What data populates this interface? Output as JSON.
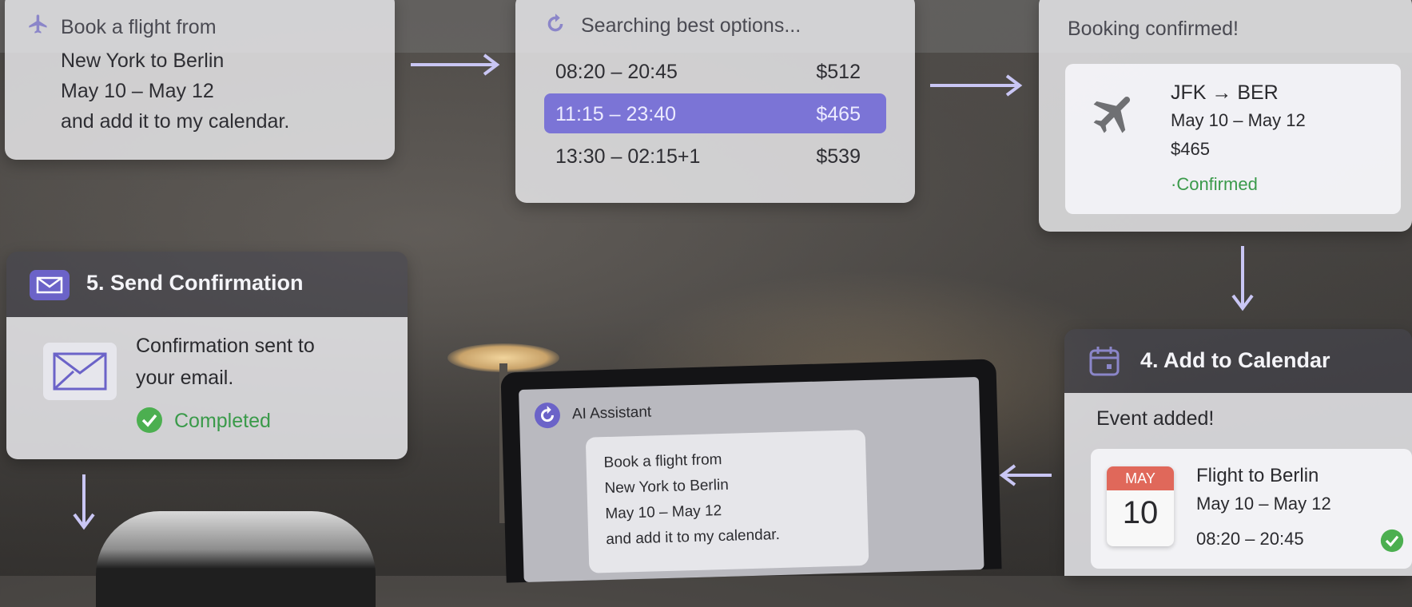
{
  "request_card": {
    "title": "Book a flight from",
    "lines": [
      "New York to Berlin",
      "May 10 – May 12",
      "and add it to my calendar."
    ]
  },
  "search_card": {
    "title": "Searching best options...",
    "options": [
      {
        "time": "08:20 – 20:45",
        "price": "$512"
      },
      {
        "time": "11:15 – 23:40",
        "price": "$465",
        "selected": true
      },
      {
        "time": "13:30 – 02:15+1",
        "price": "$539"
      }
    ]
  },
  "booking_card": {
    "title": "Booking confirmed!",
    "route": "JFK → BER",
    "dates": "May 10 – May 12",
    "price": "$465",
    "status": "·Confirmed"
  },
  "send_card": {
    "title": "5. Send Confirmation",
    "message_line1": "Confirmation sent to",
    "message_line2": "your email.",
    "status": "Completed"
  },
  "calendar_card": {
    "title": "4. Add to Calendar",
    "subtitle": "Event added!",
    "month": "MAY",
    "day": "10",
    "event_title": "Flight to Berlin",
    "event_dates": "May 10 – May 12",
    "event_time": "08:20 – 20:45"
  },
  "assistant": {
    "title": "AI Assistant",
    "message_lines": [
      "Book a flight from",
      "New York to Berlin",
      "May 10 – May 12",
      "and add it to my calendar."
    ]
  },
  "colors": {
    "accent": "#7b74d6",
    "success": "#4caf50",
    "calendar_red": "#e0685a"
  },
  "icons": [
    "plane-icon",
    "refresh-icon",
    "envelope-icon",
    "calendar-icon",
    "checkmark-icon",
    "arrow-right-icon",
    "arrow-down-icon",
    "arrow-left-icon"
  ]
}
